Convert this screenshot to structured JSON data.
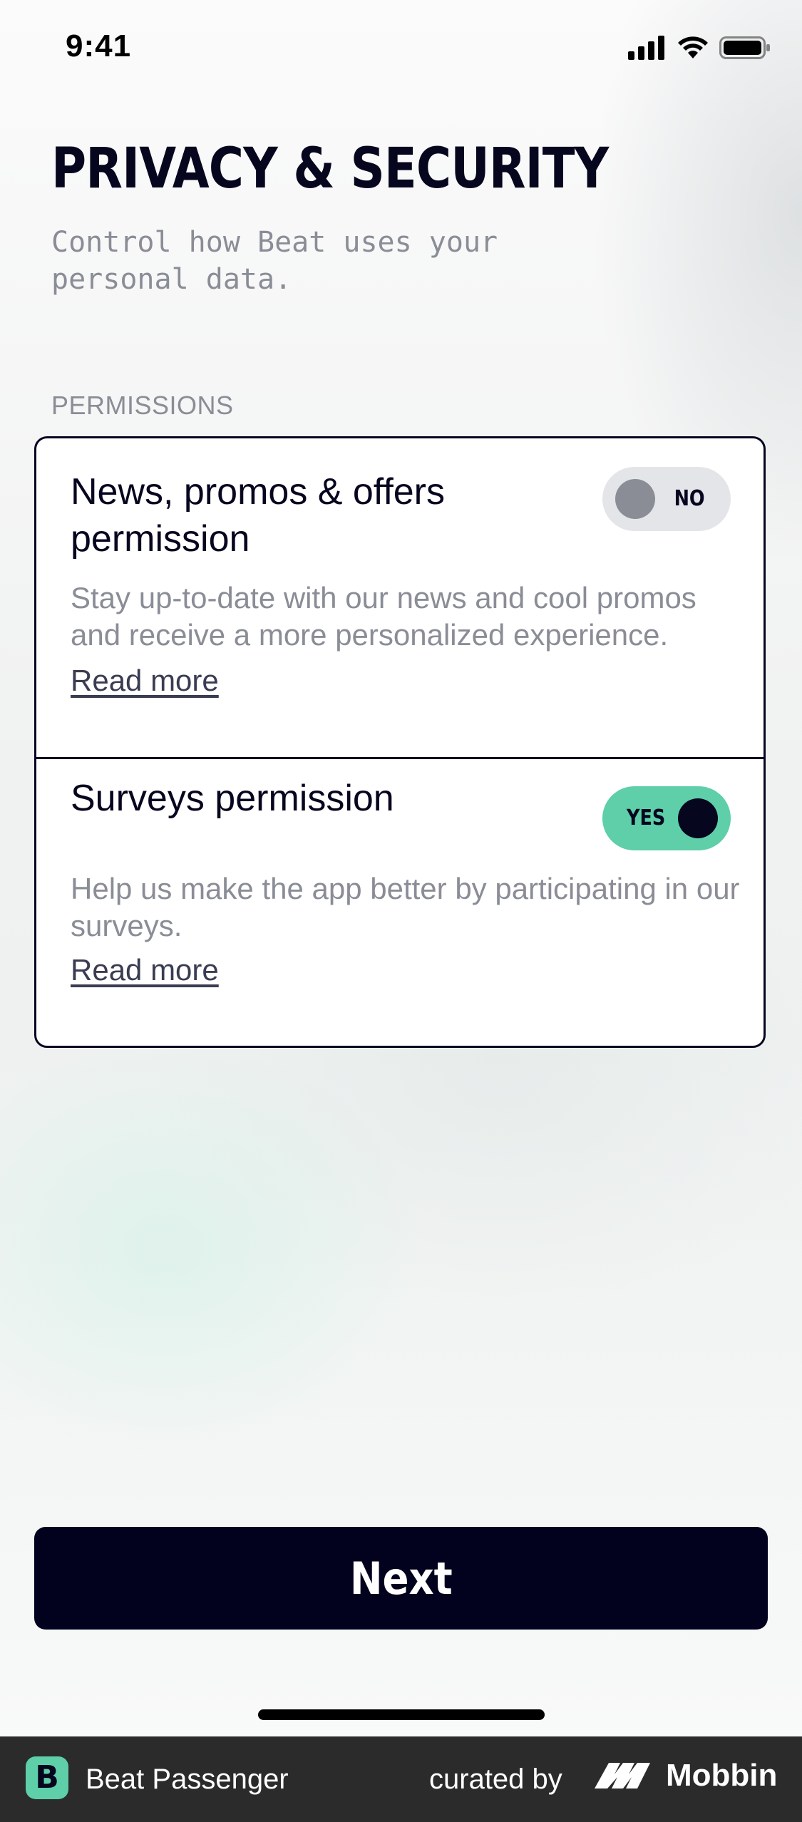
{
  "status_bar": {
    "time": "9:41",
    "icons": [
      "cellular-signal-icon",
      "wifi-icon",
      "battery-icon"
    ]
  },
  "header": {
    "title": "PRIVACY & SECURITY",
    "subtitle": "Control how Beat uses your personal data."
  },
  "permissions": {
    "section_label": "PERMISSIONS",
    "items": [
      {
        "title": "News, promos & offers permission",
        "description": "Stay up-to-date with our news and cool promos and receive a more personalized experience.",
        "link_label": "Read more",
        "toggle_label": "NO",
        "enabled": false
      },
      {
        "title": "Surveys permission",
        "description": "Help us make the app better by participating in our surveys.",
        "link_label": "Read more",
        "toggle_label": "YES",
        "enabled": true
      }
    ]
  },
  "actions": {
    "next_label": "Next"
  },
  "footer": {
    "app_icon_letter": "B",
    "app_name": "Beat Passenger",
    "curated_label": "curated by",
    "brand_name": "Mobbin"
  },
  "colors": {
    "primary_dark": "#06061f",
    "accent_green": "#5ecfa8",
    "muted_text": "#8a8d96",
    "toggle_off_track": "#e4e5e9"
  }
}
